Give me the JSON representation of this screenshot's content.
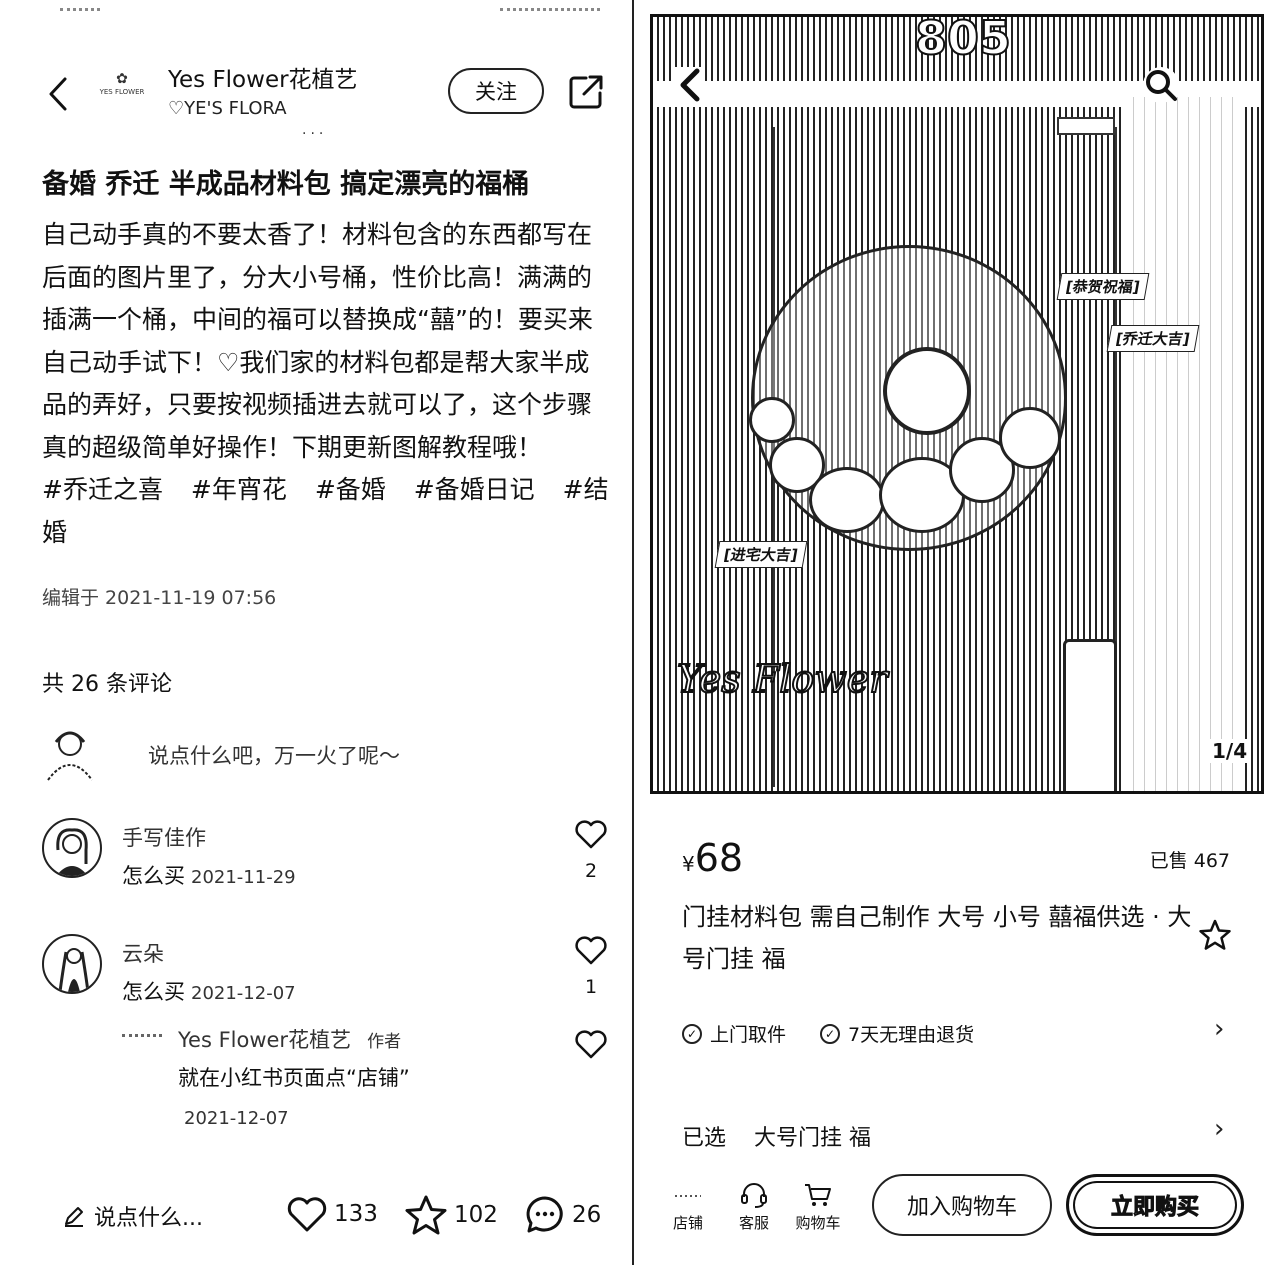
{
  "left": {
    "header": {
      "author_name": "Yes Flower花植艺",
      "author_sub": "♡YE'S FLORA",
      "logo_text": "YES FLOWER",
      "more": "···",
      "follow_label": "关注"
    },
    "post": {
      "title": "备婚 乔迁 半成品材料包 搞定漂亮的福桶",
      "body": "自己动手真的不要太香了！材料包含的东西都写在后面的图片里了，分大小号桶，性价比高！满满的插满一个桶，中间的福可以替换成“囍”的！要买来自己动手试下！♡我们家的材料包都是帮大家半成品的弄好，只要按视频插进去就可以了，这个步骤真的超级简单好操作！下期更新图解教程哦！",
      "tags": [
        "#乔迁之喜",
        "#年宵花",
        "#备婚",
        "#备婚日记",
        "#结婚"
      ],
      "edit_time": "编辑于 2021-11-19 07:56"
    },
    "comments_header": {
      "count_text": "共 26 条评论",
      "input_placeholder": "说点什么吧，万一火了呢～"
    },
    "comments": [
      {
        "user": "手写佳作",
        "text": "怎么买",
        "date": "2021-11-29",
        "likes": "2"
      },
      {
        "user": "云朵",
        "text": "怎么买",
        "date": "2021-12-07",
        "likes": "1"
      }
    ],
    "reply": {
      "user": "Yes Flower花植艺",
      "tag": "作者",
      "text": "就在小红书页面点“店铺”",
      "date": "2021-12-07"
    },
    "bottom_bar": {
      "say_label": "说点什么...",
      "likes": "133",
      "stars": "102",
      "comments": "26"
    }
  },
  "right": {
    "photo": {
      "counter": "805",
      "stickers": [
        "[恭贺祝福]",
        "[乔迁大吉]",
        "[进宅大吉]"
      ],
      "signature": "Yes Flower",
      "page_num": "1/4"
    },
    "product": {
      "currency": "¥",
      "price": "68",
      "sold": "已售 467",
      "title": "门挂材料包 需自己制作  大号 小号 囍福供选 · 大号门挂 福"
    },
    "services": [
      "上门取件",
      "7天无理由退货"
    ],
    "selected": {
      "label": "已选",
      "value": "大号门挂 福"
    },
    "actions": {
      "shop": "店铺",
      "service": "客服",
      "cart": "购物车",
      "add_to_cart": "加入购物车",
      "buy_now": "立即购买"
    }
  },
  "colors": {
    "ink": "#111111",
    "background": "#ffffff",
    "muted": "#444444"
  }
}
